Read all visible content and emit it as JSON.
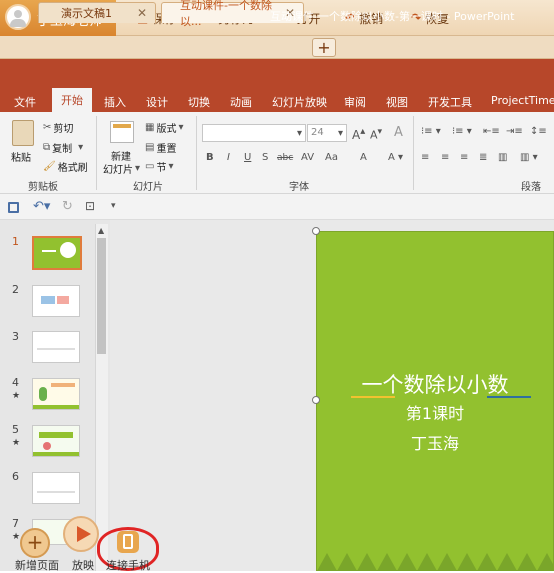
{
  "topbar": {
    "user_name": "丁玉海老师",
    "save": "保存",
    "save_as": "另存为",
    "open": "打开",
    "undo": "撤销",
    "redo": "恢复"
  },
  "tabs": [
    {
      "label": "演示文稿1"
    },
    {
      "label": "互动课件-一个数除以..."
    }
  ],
  "new_tab": "+",
  "window_title": "互动课件-一个数除以小数-第一课时 - PowerPoint",
  "ribbon_tabs": [
    "文件",
    "开始",
    "插入",
    "设计",
    "切换",
    "动画",
    "幻灯片放映",
    "审阅",
    "视图",
    "开发工具",
    "ProjectTimeLi"
  ],
  "ribbon": {
    "paste": "粘贴",
    "cut": "剪切",
    "copy": "复制",
    "format_painter": "格式刷",
    "clipboard": "剪贴板",
    "new_slide_1": "新建",
    "new_slide_2": "幻灯片",
    "layout": "版式",
    "reset": "重置",
    "section": "节",
    "slides": "幻灯片",
    "font_size": "24",
    "font": "字体",
    "paragraph": "段落"
  },
  "slides": [
    {
      "num": "1",
      "star": ""
    },
    {
      "num": "2",
      "star": ""
    },
    {
      "num": "3",
      "star": ""
    },
    {
      "num": "4",
      "star": "★"
    },
    {
      "num": "5",
      "star": "★"
    },
    {
      "num": "6",
      "star": ""
    },
    {
      "num": "7",
      "star": "★"
    }
  ],
  "slide_content": {
    "title": "一个数除以小数",
    "subtitle": "第1课时",
    "author": "丁玉海"
  },
  "bottom": {
    "new_page": "新增页面",
    "play": "放映",
    "connect": "连接手机"
  },
  "colors": {
    "accent": "#b7472a",
    "slide_bg": "#92c12f",
    "topbar_orange": "#d9852f"
  }
}
